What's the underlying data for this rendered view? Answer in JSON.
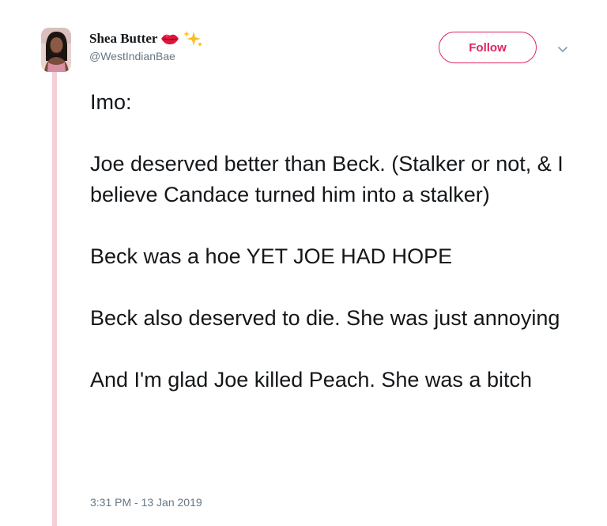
{
  "author": {
    "display_name": "Shea Butter",
    "handle": "@WestIndianBae",
    "name_emojis": [
      "lips-emoji",
      "sparkles-emoji"
    ],
    "avatar": "user-avatar-photo"
  },
  "actions": {
    "follow_label": "Follow",
    "more_icon": "chevron-down-icon"
  },
  "colors": {
    "accent": "#e0245e",
    "thread_line": "#f5cfd8",
    "text": "#14171a",
    "muted": "#657786"
  },
  "tweet": {
    "paragraphs": [
      "Imo:",
      "Joe deserved better than Beck. (Stalker or not, & I believe Candace turned him into a stalker)",
      "Beck was a hoe YET JOE HAD HOPE",
      "Beck also deserved to die. She was just annoying",
      "And I'm glad Joe killed Peach. She was a bitch"
    ],
    "timestamp": "3:31 PM - 13 Jan 2019"
  }
}
